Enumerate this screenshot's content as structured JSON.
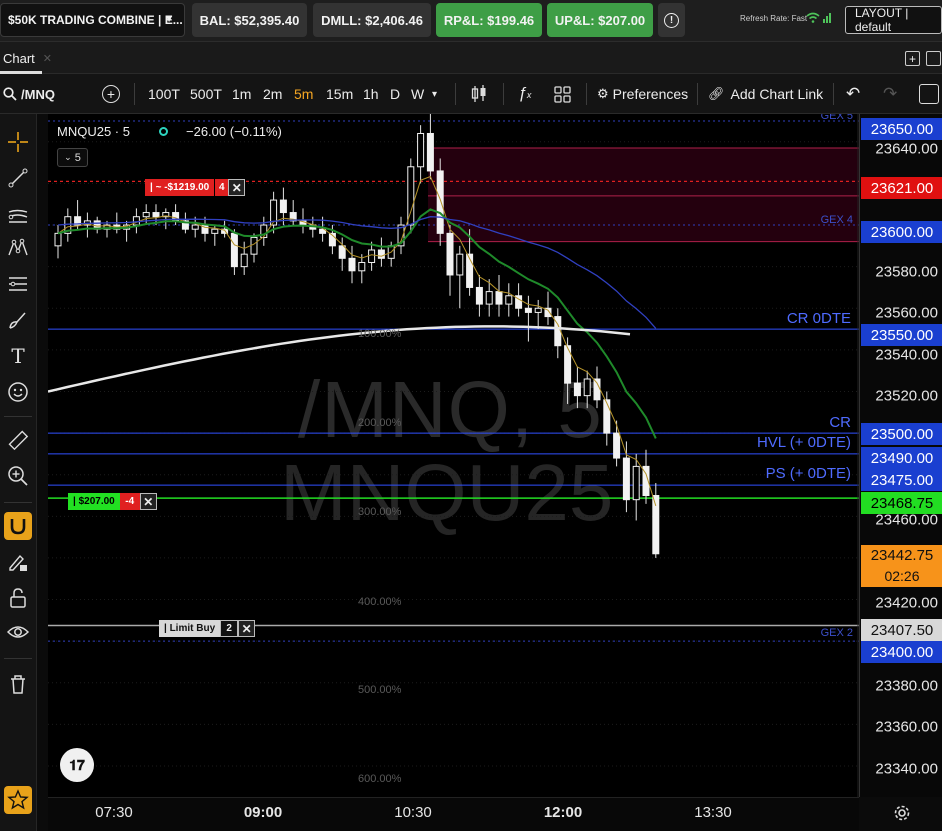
{
  "topbar": {
    "account": "$50K TRADING COMBINE | E...",
    "balance": "BAL: $52,395.40",
    "dmll": "DMLL: $2,406.46",
    "rpl": "RP&L: $199.46",
    "upl": "UP&L: $207.00",
    "refresh": "Refresh Rate: Fast",
    "layout": "LAYOUT | default"
  },
  "tabs": {
    "chart": "Chart"
  },
  "toolbar": {
    "symbol": "/MNQ",
    "intervals": [
      "100T",
      "500T",
      "1m",
      "2m",
      "5m",
      "15m",
      "1h",
      "D",
      "W"
    ],
    "active_interval": "5m",
    "preferences": "Preferences",
    "add_chart_link": "Add Chart Link"
  },
  "legend": {
    "symbol": "MNQU25 · 5",
    "change": "−26.00 (−0.11%)",
    "collapse": "5"
  },
  "watermark": {
    "line1": "/MNQ, 5",
    "line2": "MNQU25"
  },
  "levels": {
    "cr0dte": "CR 0DTE",
    "cr": "CR",
    "hvl": "HVL (+ 0DTE)",
    "ps": "PS (+ 0DTE)",
    "gex5": "GEX 5",
    "gex4": "GEX 4",
    "gex2": "GEX 2"
  },
  "percent_labels": [
    "100.00%",
    "200.00%",
    "300.00%",
    "400.00%",
    "500.00%",
    "600.00%"
  ],
  "orders": {
    "stop": {
      "label": "| ~ -$1219.00",
      "qty": "4"
    },
    "position": {
      "label": "| $207.00",
      "qty": "-4"
    },
    "limit": {
      "label": "| Limit Buy",
      "qty": "2"
    }
  },
  "price_axis": {
    "ticks": [
      "23640.00",
      "23580.00",
      "23560.00",
      "23540.00",
      "23520.00",
      "23460.00",
      "23420.00",
      "23380.00",
      "23360.00",
      "23340.00"
    ],
    "boxes": {
      "p23650": "23650.00",
      "p23621": "23621.00",
      "p23600": "23600.00",
      "p23550": "23550.00",
      "p23500": "23500.00",
      "p23490": "23490.00",
      "p23475": "23475.00",
      "p23468": "23468.75",
      "last": "23442.75",
      "countdown": "02:26",
      "p23407": "23407.50",
      "p23400": "23400.00"
    }
  },
  "time_axis": [
    "07:30",
    "09:00",
    "10:30",
    "12:00",
    "13:30"
  ],
  "colors": {
    "up": "#3e9e46",
    "accent": "#f5a623",
    "level": "#4f6bff"
  },
  "chart_data": {
    "type": "candlestick",
    "title": "MNQU25 · 5",
    "y_range": [
      23330,
      23655
    ],
    "x_labels": [
      "07:30",
      "09:00",
      "10:30",
      "12:00",
      "13:30"
    ],
    "candles": [
      [
        23590,
        23600,
        23584,
        23596
      ],
      [
        23596,
        23608,
        23592,
        23604
      ],
      [
        23604,
        23612,
        23598,
        23600
      ],
      [
        23600,
        23606,
        23594,
        23602
      ],
      [
        23602,
        23604,
        23596,
        23598
      ],
      [
        23598,
        23602,
        23594,
        23600
      ],
      [
        23600,
        23606,
        23596,
        23598
      ],
      [
        23598,
        23602,
        23592,
        23600
      ],
      [
        23600,
        23608,
        23596,
        23604
      ],
      [
        23604,
        23610,
        23600,
        23606
      ],
      [
        23606,
        23610,
        23600,
        23604
      ],
      [
        23604,
        23608,
        23598,
        23606
      ],
      [
        23606,
        23610,
        23600,
        23602
      ],
      [
        23602,
        23606,
        23596,
        23598
      ],
      [
        23598,
        23604,
        23594,
        23600
      ],
      [
        23600,
        23604,
        23592,
        23596
      ],
      [
        23596,
        23600,
        23590,
        23598
      ],
      [
        23598,
        23602,
        23594,
        23596
      ],
      [
        23596,
        23598,
        23576,
        23580
      ],
      [
        23580,
        23592,
        23576,
        23586
      ],
      [
        23586,
        23596,
        23582,
        23594
      ],
      [
        23594,
        23604,
        23590,
        23600
      ],
      [
        23600,
        23616,
        23596,
        23612
      ],
      [
        23612,
        23618,
        23600,
        23606
      ],
      [
        23606,
        23612,
        23600,
        23602
      ],
      [
        23602,
        23608,
        23596,
        23600
      ],
      [
        23600,
        23604,
        23594,
        23598
      ],
      [
        23598,
        23604,
        23592,
        23596
      ],
      [
        23596,
        23600,
        23586,
        23590
      ],
      [
        23590,
        23594,
        23578,
        23584
      ],
      [
        23584,
        23590,
        23572,
        23578
      ],
      [
        23578,
        23586,
        23572,
        23582
      ],
      [
        23582,
        23592,
        23578,
        23588
      ],
      [
        23588,
        23594,
        23580,
        23584
      ],
      [
        23584,
        23592,
        23580,
        23590
      ],
      [
        23590,
        23604,
        23586,
        23600
      ],
      [
        23600,
        23632,
        23596,
        23628
      ],
      [
        23628,
        23648,
        23620,
        23644
      ],
      [
        23644,
        23654,
        23622,
        23626
      ],
      [
        23626,
        23632,
        23590,
        23596
      ],
      [
        23596,
        23600,
        23566,
        23576
      ],
      [
        23576,
        23590,
        23560,
        23586
      ],
      [
        23586,
        23598,
        23566,
        23570
      ],
      [
        23570,
        23576,
        23556,
        23562
      ],
      [
        23562,
        23574,
        23556,
        23568
      ],
      [
        23568,
        23576,
        23556,
        23562
      ],
      [
        23562,
        23572,
        23556,
        23566
      ],
      [
        23566,
        23572,
        23556,
        23560
      ],
      [
        23560,
        23566,
        23544,
        23558
      ],
      [
        23558,
        23564,
        23550,
        23560
      ],
      [
        23560,
        23568,
        23552,
        23556
      ],
      [
        23556,
        23560,
        23536,
        23542
      ],
      [
        23542,
        23546,
        23514,
        23524
      ],
      [
        23524,
        23532,
        23512,
        23518
      ],
      [
        23518,
        23530,
        23512,
        23526
      ],
      [
        23526,
        23532,
        23512,
        23516
      ],
      [
        23516,
        23520,
        23494,
        23500
      ],
      [
        23500,
        23506,
        23484,
        23488
      ],
      [
        23488,
        23496,
        23462,
        23468
      ],
      [
        23468,
        23490,
        23458,
        23484
      ],
      [
        23484,
        23492,
        23466,
        23470
      ],
      [
        23470,
        23476,
        23440,
        23442
      ]
    ]
  }
}
